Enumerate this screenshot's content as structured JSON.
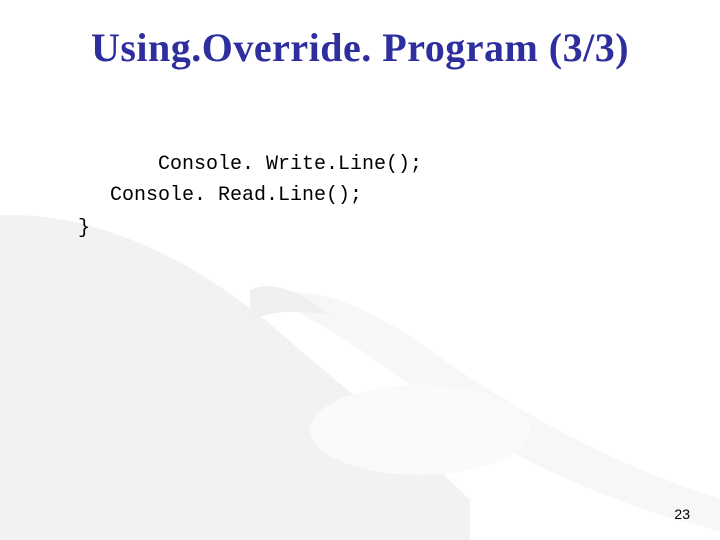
{
  "slide": {
    "title": "Using.Override. Program (3/3)",
    "code": {
      "line1": "Console. Write.Line();",
      "line2": "Console. Read.Line();",
      "close_brace": "}"
    },
    "page_number": "23"
  }
}
